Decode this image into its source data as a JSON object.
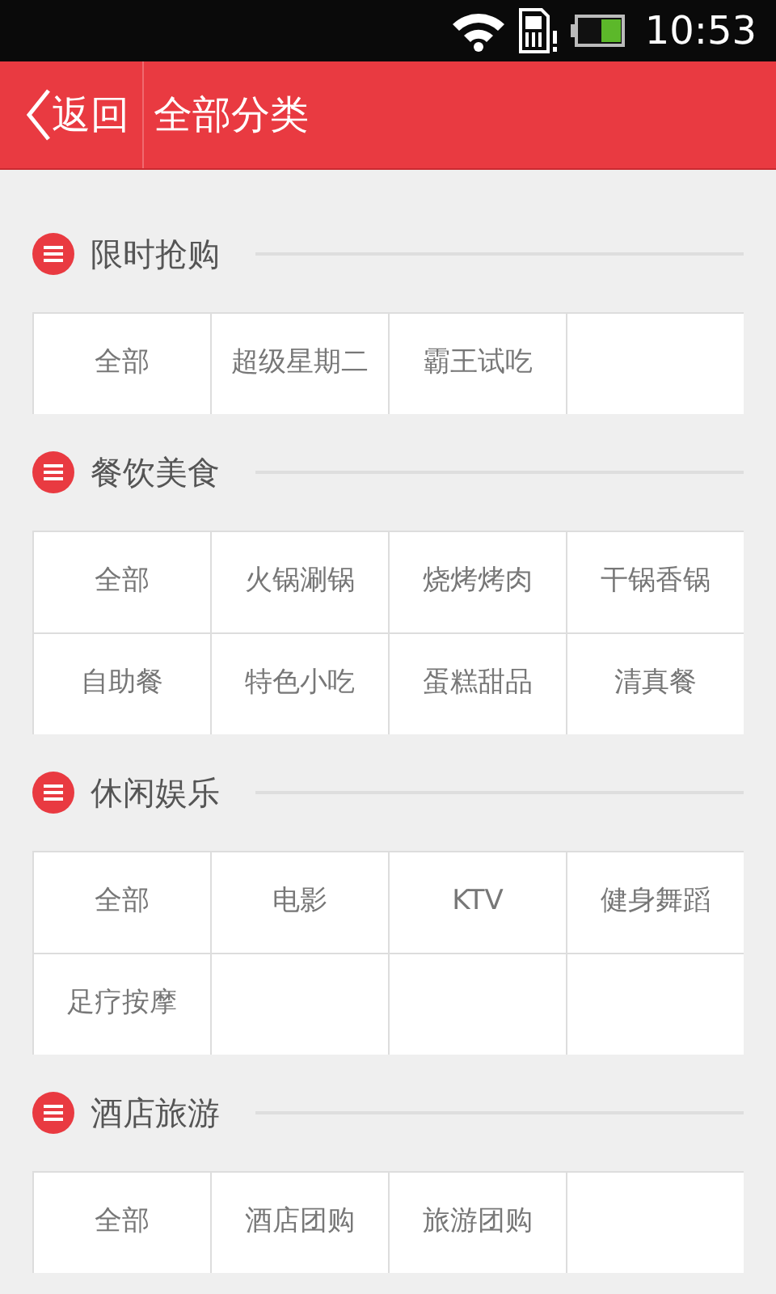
{
  "status_bar": {
    "time": "10:53"
  },
  "header": {
    "back": "返回",
    "title": "全部分类"
  },
  "sections": [
    {
      "title": "限时抢购",
      "items": [
        "全部",
        "超级星期二",
        "霸王试吃"
      ]
    },
    {
      "title": "餐饮美食",
      "items": [
        "全部",
        "火锅涮锅",
        "烧烤烤肉",
        "干锅香锅",
        "自助餐",
        "特色小吃",
        "蛋糕甜品",
        "清真餐"
      ]
    },
    {
      "title": "休闲娱乐",
      "items": [
        "全部",
        "电影",
        "KTV",
        "健身舞蹈",
        "足疗按摩"
      ]
    },
    {
      "title": "酒店旅游",
      "items": [
        "全部",
        "酒店团购",
        "旅游团购"
      ]
    }
  ]
}
